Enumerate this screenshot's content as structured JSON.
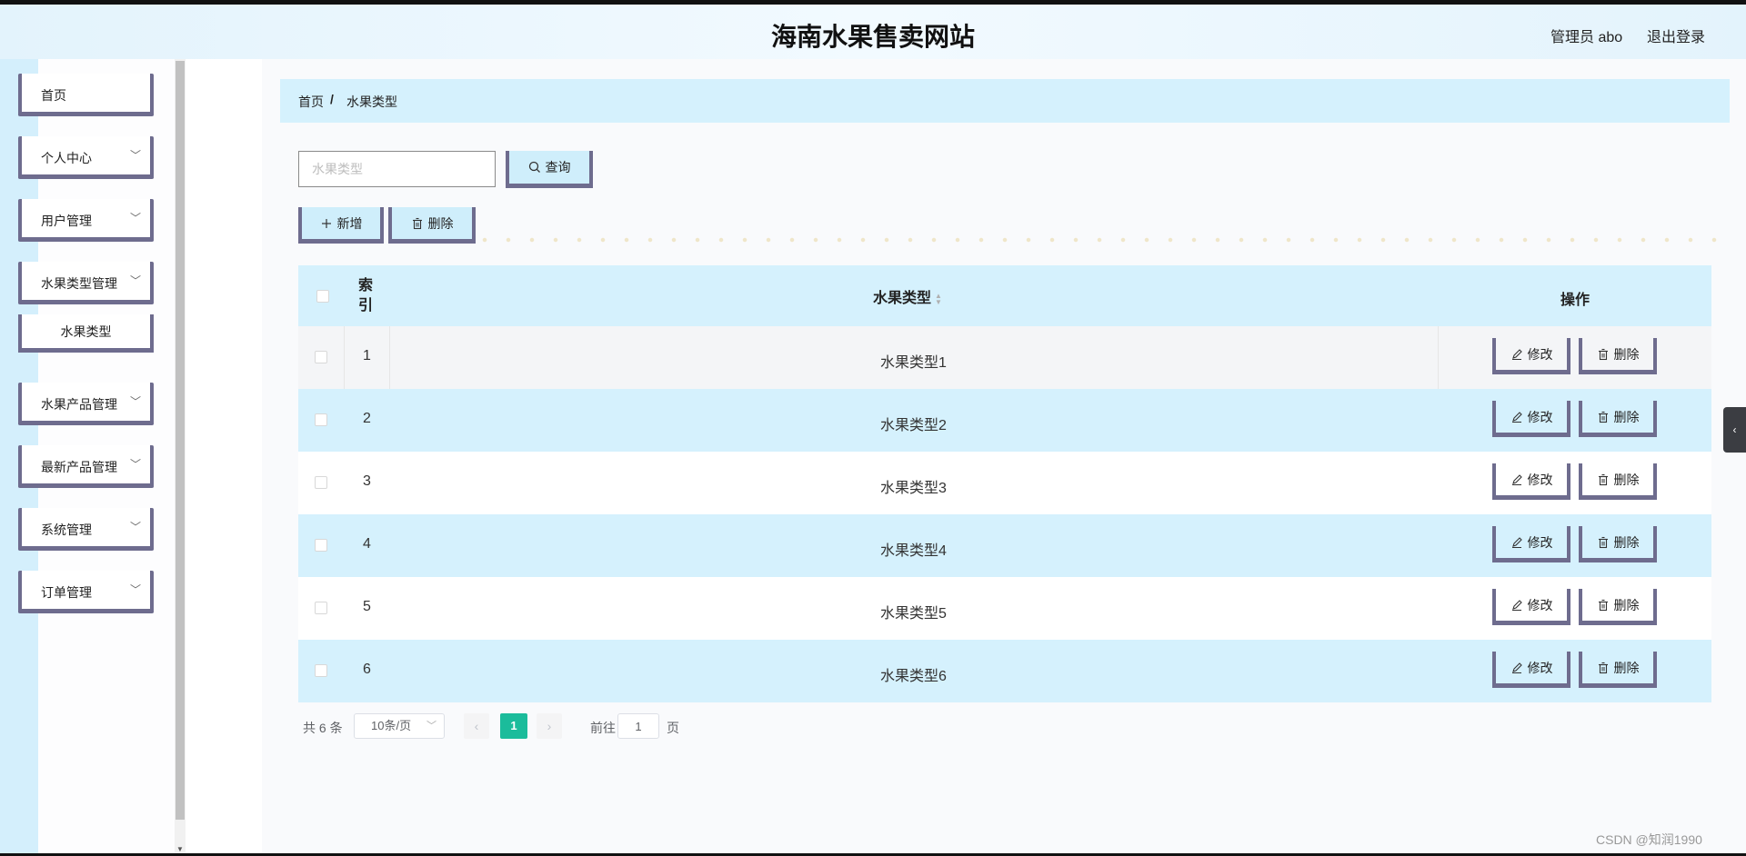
{
  "header": {
    "title": "海南水果售卖网站",
    "user": "管理员 abo",
    "logout": "退出登录"
  },
  "sidebar": {
    "items": [
      {
        "label": "首页"
      },
      {
        "label": "个人中心"
      },
      {
        "label": "用户管理"
      },
      {
        "label": "水果类型管理"
      },
      {
        "label": "水果类型"
      },
      {
        "label": "水果产品管理"
      },
      {
        "label": "最新产品管理"
      },
      {
        "label": "系统管理"
      },
      {
        "label": "订单管理"
      }
    ]
  },
  "breadcrumb": {
    "home": "首页",
    "separator": "/",
    "current": "水果类型"
  },
  "search": {
    "placeholder": "水果类型",
    "value": "",
    "query_label": "查询"
  },
  "toolbar": {
    "add_label": "新增",
    "delete_label": "删除"
  },
  "table": {
    "headers": {
      "index": "索引",
      "type": "水果类型",
      "ops": "操作"
    },
    "rows": [
      {
        "index": "1",
        "type": "水果类型1",
        "edit": "修改",
        "delete": "删除"
      },
      {
        "index": "2",
        "type": "水果类型2",
        "edit": "修改",
        "delete": "删除"
      },
      {
        "index": "3",
        "type": "水果类型3",
        "edit": "修改",
        "delete": "删除"
      },
      {
        "index": "4",
        "type": "水果类型4",
        "edit": "修改",
        "delete": "删除"
      },
      {
        "index": "5",
        "type": "水果类型5",
        "edit": "修改",
        "delete": "删除"
      },
      {
        "index": "6",
        "type": "水果类型6",
        "edit": "修改",
        "delete": "删除"
      }
    ]
  },
  "pagination": {
    "total": "共 6 条",
    "page_size": "10条/页",
    "current_page": "1",
    "goto_prefix": "前往",
    "goto_value": "1",
    "goto_suffix": "页"
  },
  "watermark": "CSDN @知润1990",
  "colors": {
    "accent_blue": "#d5f1fd",
    "button_border": "#6e6c8e",
    "page_active": "#1bbc9b"
  }
}
